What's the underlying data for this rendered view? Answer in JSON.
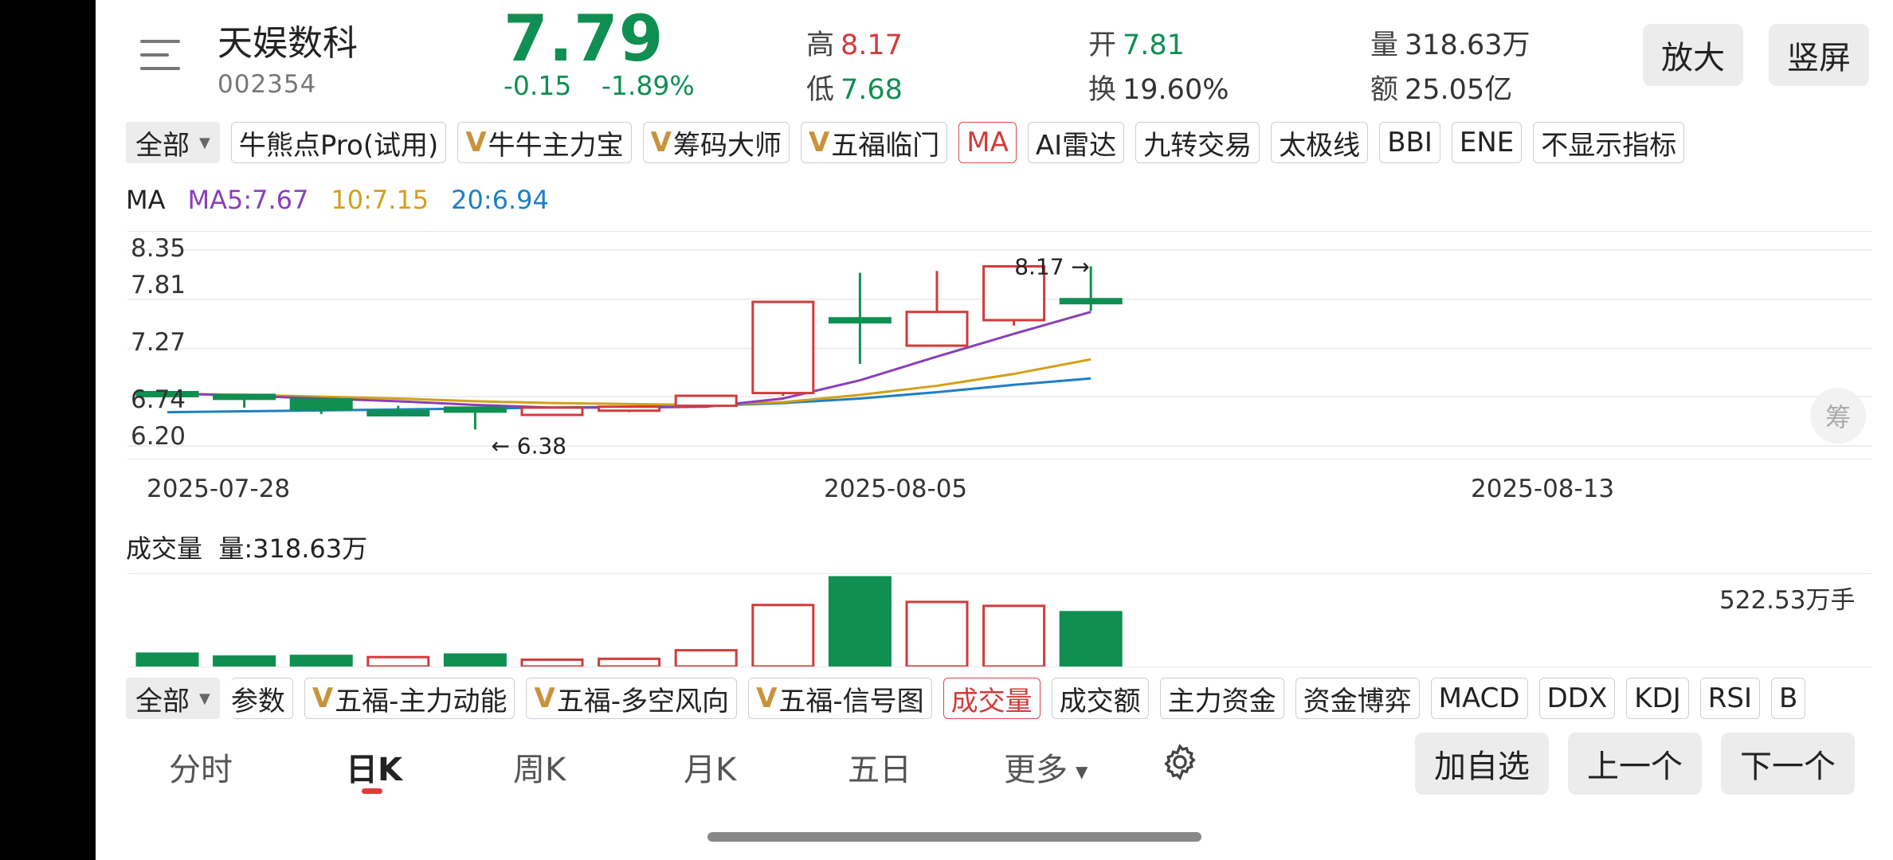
{
  "header": {
    "stock_name": "天娱数科",
    "stock_code": "002354",
    "price": "7.79",
    "change": "-0.15",
    "change_pct": "-1.89%",
    "stats": {
      "high_label": "高",
      "high": "8.17",
      "low_label": "低",
      "low": "7.68",
      "open_label": "开",
      "open": "7.81",
      "turnover_label": "换",
      "turnover": "19.60%",
      "volume_label": "量",
      "volume": "318.63万",
      "amount_label": "额",
      "amount": "25.05亿"
    },
    "zoom_label": "放大",
    "portrait_label": "竖屏"
  },
  "top_indicators": {
    "all_label": "全部",
    "items": [
      "牛熊点Pro(试用)",
      "牛牛主力宝",
      "筹码大师",
      "五福临门",
      "MA",
      "AI雷达",
      "九转交易",
      "太极线",
      "BBI",
      "ENE",
      "不显示指标"
    ]
  },
  "ma_legend": {
    "title": "MA",
    "ma5": "MA5:7.67",
    "ma10": "10:7.15",
    "ma20": "20:6.94"
  },
  "chart_data": {
    "type": "candlestick",
    "y_ticks": [
      "8.35",
      "7.81",
      "7.27",
      "6.74",
      "6.20"
    ],
    "x_ticks": [
      "2025-07-28",
      "2025-08-05",
      "2025-08-13"
    ],
    "high_annotation": "8.17",
    "low_annotation": "6.38",
    "candles": [
      {
        "open": 6.79,
        "close": 6.75,
        "high": 6.79,
        "low": 6.75
      },
      {
        "open": 6.76,
        "close": 6.73,
        "high": 6.76,
        "low": 6.62
      },
      {
        "open": 6.71,
        "close": 6.6,
        "high": 6.71,
        "low": 6.55
      },
      {
        "open": 6.58,
        "close": 6.56,
        "high": 6.64,
        "low": 6.56
      },
      {
        "open": 6.62,
        "close": 6.58,
        "high": 6.62,
        "low": 6.38
      },
      {
        "open": 6.54,
        "close": 6.62,
        "high": 6.62,
        "low": 6.54
      },
      {
        "open": 6.6,
        "close": 6.63,
        "high": 6.63,
        "low": 6.57
      },
      {
        "open": 6.64,
        "close": 6.75,
        "high": 6.75,
        "low": 6.64
      },
      {
        "open": 6.78,
        "close": 7.78,
        "high": 7.78,
        "low": 6.75
      },
      {
        "open": 7.6,
        "close": 7.58,
        "high": 8.1,
        "low": 7.1
      },
      {
        "open": 7.3,
        "close": 7.67,
        "high": 8.12,
        "low": 7.3
      },
      {
        "open": 7.58,
        "close": 8.17,
        "high": 8.15,
        "low": 7.52
      },
      {
        "open": 7.81,
        "close": 7.79,
        "high": 8.17,
        "low": 7.68
      }
    ],
    "ma5": [
      6.78,
      6.75,
      6.72,
      6.69,
      6.65,
      6.62,
      6.62,
      6.63,
      6.72,
      6.92,
      7.18,
      7.43,
      7.67
    ],
    "ma10": [
      6.77,
      6.76,
      6.74,
      6.72,
      6.69,
      6.67,
      6.66,
      6.65,
      6.68,
      6.76,
      6.86,
      6.99,
      7.15
    ],
    "ma20": [
      6.57,
      6.58,
      6.59,
      6.6,
      6.61,
      6.62,
      6.63,
      6.64,
      6.67,
      6.72,
      6.79,
      6.87,
      6.94
    ],
    "volume": {
      "title": "成交量",
      "label": "量:318.63万",
      "max_label": "522.53万手",
      "values": [
        75,
        58,
        62,
        55,
        70,
        40,
        45,
        95,
        360,
        522,
        378,
        355,
        318
      ],
      "up": [
        false,
        false,
        false,
        true,
        false,
        true,
        true,
        true,
        true,
        false,
        true,
        true,
        false
      ]
    },
    "colors": {
      "up": "#d23b3b",
      "down": "#0f8f51",
      "ma5": "#8a3fb8",
      "ma10": "#d4a017",
      "ma20": "#1f7fc4"
    }
  },
  "bottom_indicators": {
    "all_label": "全部",
    "items": [
      "参数",
      "五福-主力动能",
      "五福-多空风向",
      "五福-信号图",
      "成交量",
      "成交额",
      "主力资金",
      "资金博弈",
      "MACD",
      "DDX",
      "KDJ",
      "RSI",
      "B"
    ]
  },
  "period_tabs": [
    "分时",
    "日K",
    "周K",
    "月K",
    "五日",
    "更多"
  ],
  "footer_buttons": {
    "add": "加自选",
    "prev": "上一个",
    "next": "下一个"
  }
}
